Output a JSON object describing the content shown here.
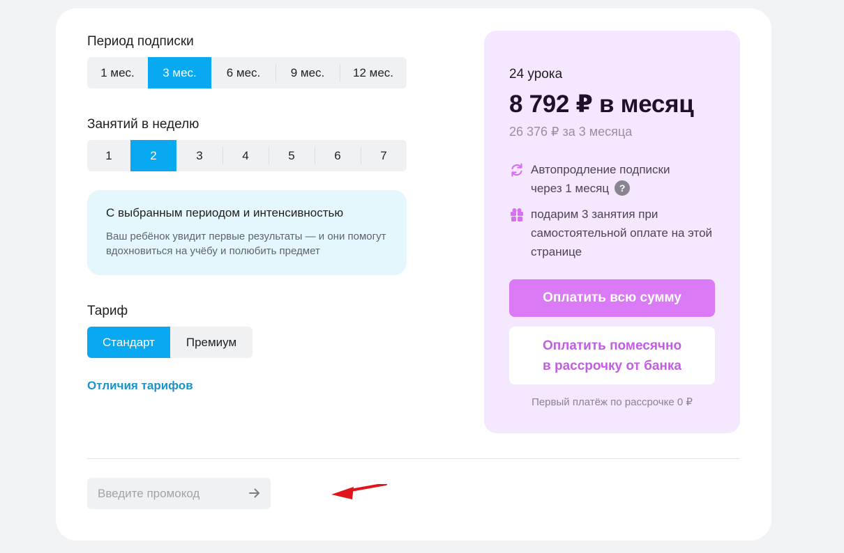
{
  "period": {
    "label": "Период подписки",
    "options": [
      "1 мес.",
      "3 мес.",
      "6 мес.",
      "9 мес.",
      "12 мес."
    ],
    "selected": "3 мес."
  },
  "frequency": {
    "label": "Занятий в неделю",
    "options": [
      "1",
      "2",
      "3",
      "4",
      "5",
      "6",
      "7"
    ],
    "selected": "2"
  },
  "info": {
    "title": "С выбранным периодом и интенсивностью",
    "text": "Ваш ребёнок увидит первые результаты — и они помогут вдохновиться на учёбу и полюбить предмет"
  },
  "tariff": {
    "label": "Тариф",
    "options": [
      "Стандарт",
      "Премиум"
    ],
    "selected": "Стандарт",
    "compare_link": "Отличия тарифов"
  },
  "promo": {
    "placeholder": "Введите промокод",
    "submit_icon": "arrow-right-icon"
  },
  "summary": {
    "lessons": "24 урока",
    "price": "8 792 ₽ в месяц",
    "total": "26 376 ₽ за 3 месяца",
    "autorenew_line1": "Автопродление подписки",
    "autorenew_line2": "через 1 месяц",
    "help_mark": "?",
    "gift": "подарим 3 занятия при самостоятельной оплате на этой странице",
    "pay_full": "Оплатить всю сумму",
    "pay_monthly_line1": "Оплатить помесячно",
    "pay_monthly_line2": "в рассрочку от банка",
    "first_payment": "Первый платёж по рассрочке 0 ₽"
  },
  "colors": {
    "accent_blue": "#08a9f0",
    "panel_bg": "#f5e7fd",
    "pay_button": "#db7af7",
    "link": "#1a93c6",
    "annotation_arrow": "#e0151b"
  }
}
